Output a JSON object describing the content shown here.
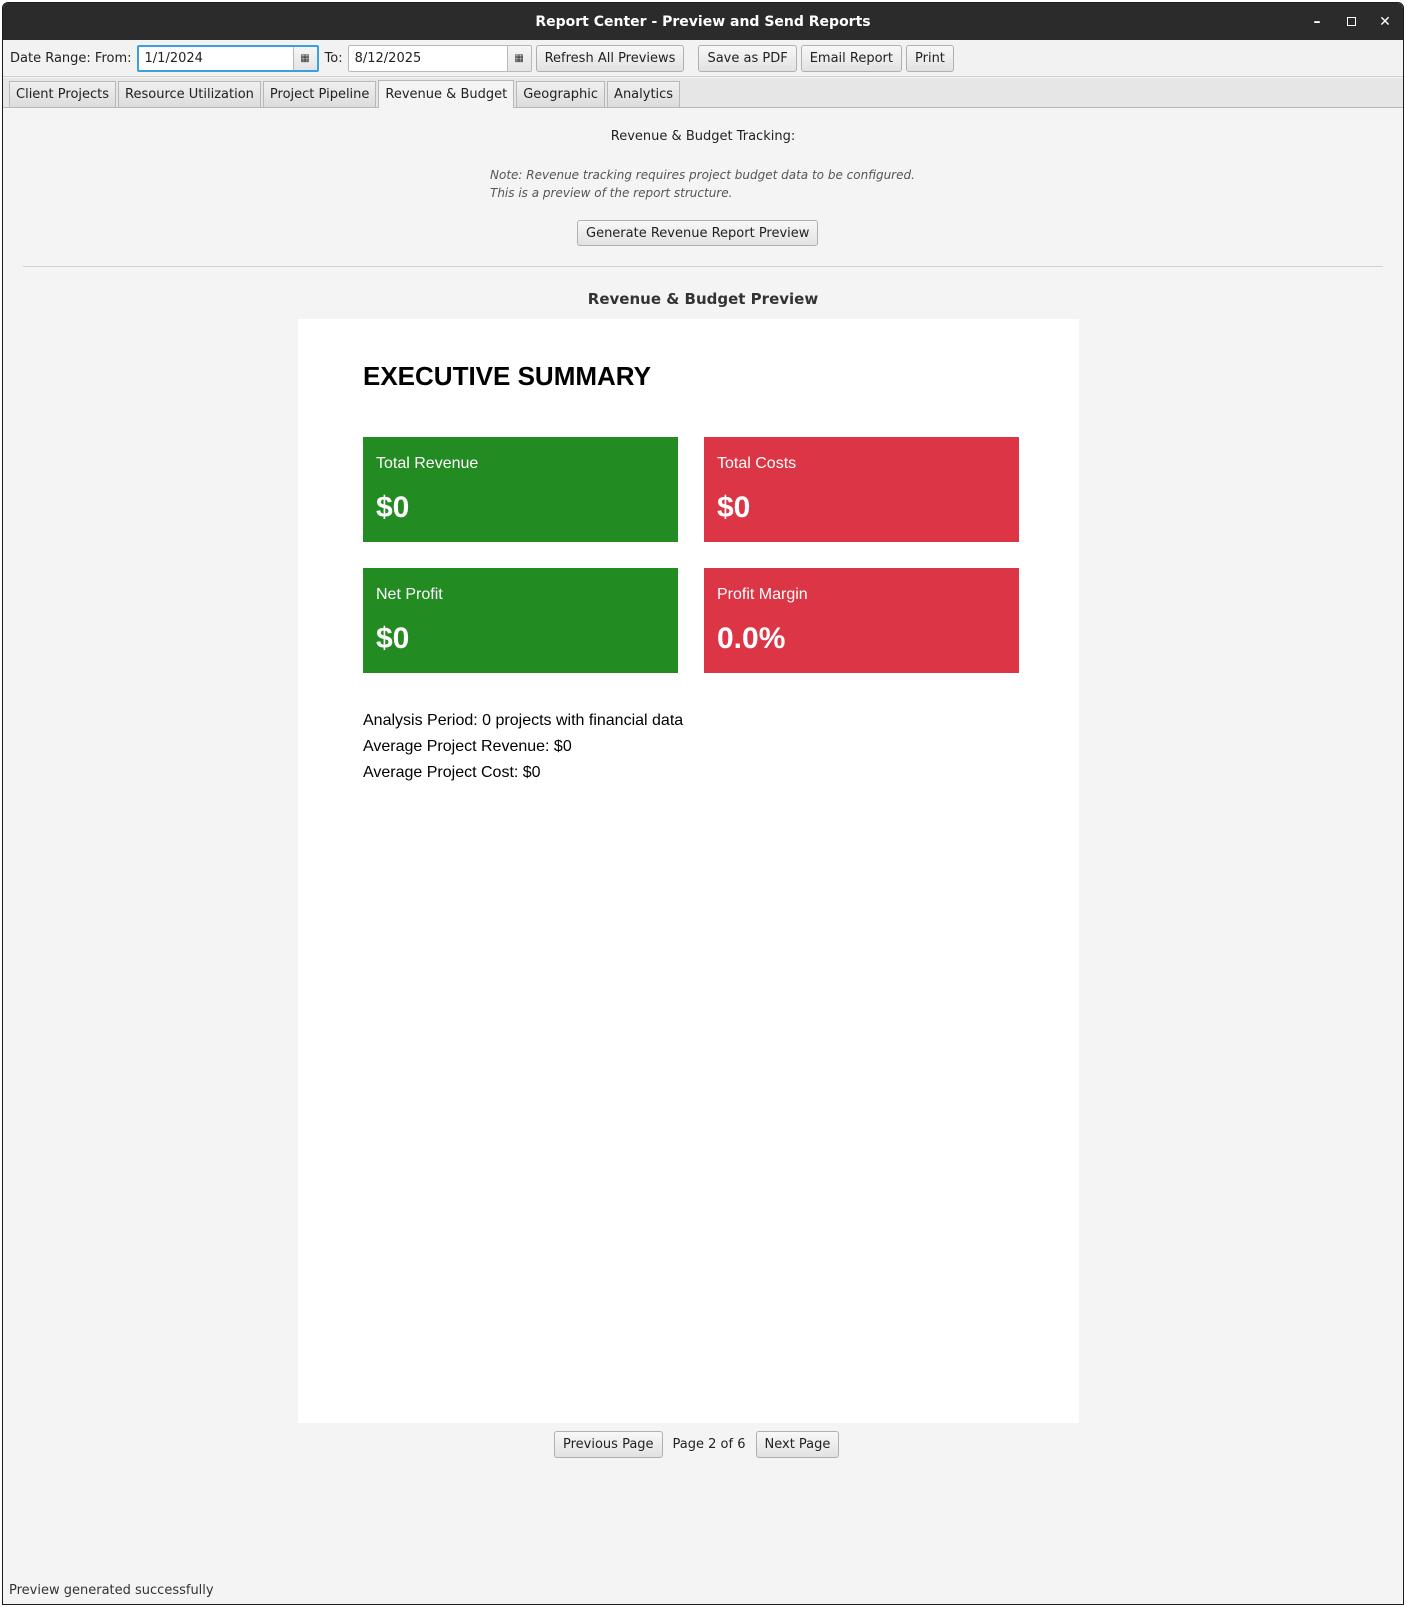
{
  "window": {
    "title": "Report Center - Preview and Send Reports"
  },
  "toolbar": {
    "date_range_label": "Date Range: From:",
    "from_value": "1/1/2024",
    "to_label": "To:",
    "to_value": "8/12/2025",
    "refresh_label": "Refresh All Previews",
    "save_pdf_label": "Save as PDF",
    "email_label": "Email Report",
    "print_label": "Print"
  },
  "tabs": [
    {
      "label": "Client Projects"
    },
    {
      "label": "Resource Utilization"
    },
    {
      "label": "Project Pipeline"
    },
    {
      "label": "Revenue & Budget",
      "active": true
    },
    {
      "label": "Geographic"
    },
    {
      "label": "Analytics"
    }
  ],
  "main": {
    "section_title": "Revenue & Budget Tracking:",
    "note_line1": "Note: Revenue tracking requires project budget data to be configured.",
    "note_line2": "This is a preview of the report structure.",
    "generate_label": "Generate Revenue Report Preview",
    "preview_title": "Revenue & Budget Preview"
  },
  "report": {
    "heading": "EXECUTIVE SUMMARY",
    "cards": [
      {
        "label": "Total Revenue",
        "value": "$0",
        "color": "#228b22"
      },
      {
        "label": "Total Costs",
        "value": "$0",
        "color": "#dc3545"
      },
      {
        "label": "Net Profit",
        "value": "$0",
        "color": "#228b22"
      },
      {
        "label": "Profit Margin",
        "value": "0.0%",
        "color": "#dc3545"
      }
    ],
    "stats": [
      "Analysis Period: 0 projects with financial data",
      "Average Project Revenue: $0",
      "Average Project Cost: $0"
    ]
  },
  "pager": {
    "prev_label": "Previous Page",
    "indicator": "Page 2 of 6",
    "next_label": "Next Page"
  },
  "status_bar": {
    "text": "Preview generated successfully"
  }
}
